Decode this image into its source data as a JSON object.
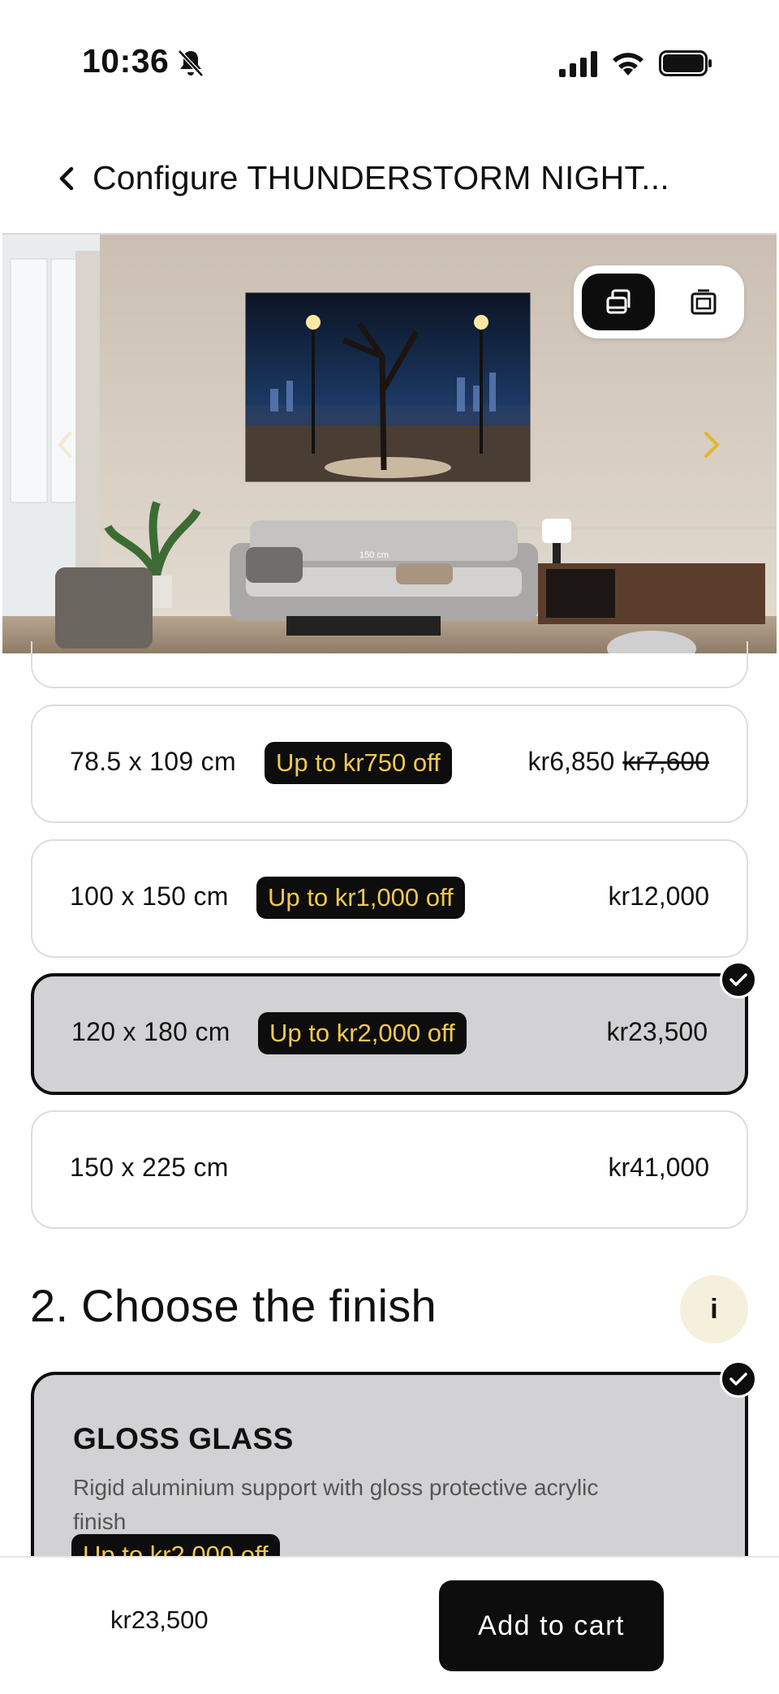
{
  "status_bar": {
    "time": "10:36",
    "icons": [
      "bell-slash-icon",
      "signal-icon",
      "wifi-icon",
      "battery-icon"
    ]
  },
  "header": {
    "title": "Configure THUNDERSTORM NIGHT...",
    "back_icon": "chevron-left-icon"
  },
  "preview": {
    "scale_label": "150 cm",
    "view_toggle": [
      "room-view-icon",
      "frame-view-icon"
    ],
    "active_view": "room-view",
    "next_icon": "chevron-right-icon"
  },
  "sizes": [
    {
      "size": "78.5 x 109 cm",
      "badge": "Up to kr750 off",
      "price": "kr6,850",
      "old_price": "kr7,600",
      "selected": false
    },
    {
      "size": "100 x 150 cm",
      "badge": "Up to kr1,000 off",
      "price": "kr12,000",
      "old_price": "",
      "selected": false
    },
    {
      "size": "120 x 180 cm",
      "badge": "Up to kr2,000 off",
      "price": "kr23,500",
      "old_price": "",
      "selected": true
    },
    {
      "size": "150 x 225 cm",
      "badge": "",
      "price": "kr41,000",
      "old_price": "",
      "selected": false
    }
  ],
  "finish_section": {
    "title": "2. Choose the finish",
    "info_label": "i",
    "cards": [
      {
        "name": "GLOSS GLASS",
        "description": "Rigid aluminium support with gloss protective acrylic finish",
        "badge": "Up to kr2,000 off",
        "selected": true
      }
    ]
  },
  "bottom_bar": {
    "price": "kr23,500",
    "cta": "Add to cart"
  },
  "colors": {
    "accent": "#0d0d0d",
    "badge_text": "#f2c94c",
    "selected_bg": "#d2d2d4",
    "info_bg": "#f5f0dc",
    "arrow": "#e3b52d"
  }
}
